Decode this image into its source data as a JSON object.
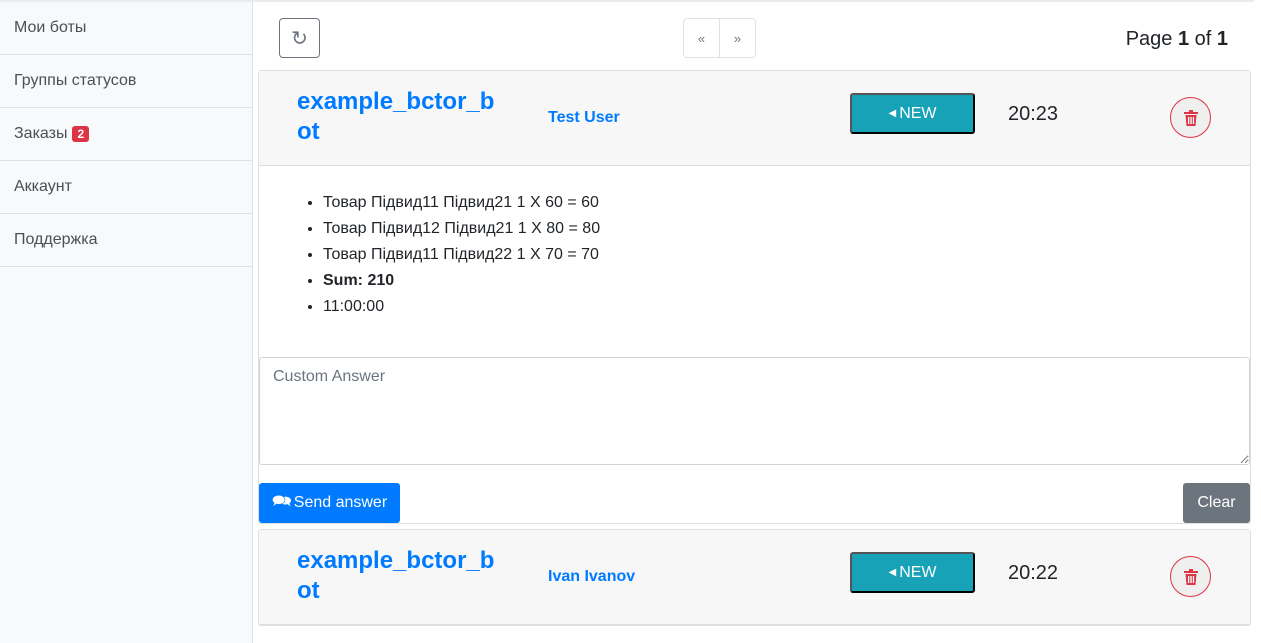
{
  "sidebar": {
    "items": [
      {
        "label": "Мои боты"
      },
      {
        "label": "Группы статусов"
      },
      {
        "label": "Заказы",
        "badge": "2"
      },
      {
        "label": "Аккаунт"
      },
      {
        "label": "Поддержка"
      }
    ]
  },
  "toolbar": {
    "prev": "«",
    "next": "»",
    "page_prefix": "Page ",
    "page_current": "1",
    "page_of": " of ",
    "page_total": "1"
  },
  "orders": [
    {
      "bot": "example_bctor_bot",
      "user": "Test User",
      "status": "NEW",
      "time": "20:23",
      "items": [
        "Товар Підвид11 Підвид21 1 X 60 = 60",
        "Товар Підвид12 Підвид21 1 X 80 = 80",
        "Товар Підвид11 Підвид22 1 X 70 = 70"
      ],
      "sum": "Sum: 210",
      "delivery_time": "11:00:00",
      "answer_placeholder": "Custom Answer",
      "send_label": "Send answer",
      "clear_label": "Clear"
    },
    {
      "bot": "example_bctor_bot",
      "user": "Ivan Ivanov",
      "status": "NEW",
      "time": "20:22"
    }
  ],
  "colors": {
    "primary": "#007bff",
    "info": "#17a2b8",
    "danger": "#dc3545",
    "secondary": "#6c757d"
  }
}
